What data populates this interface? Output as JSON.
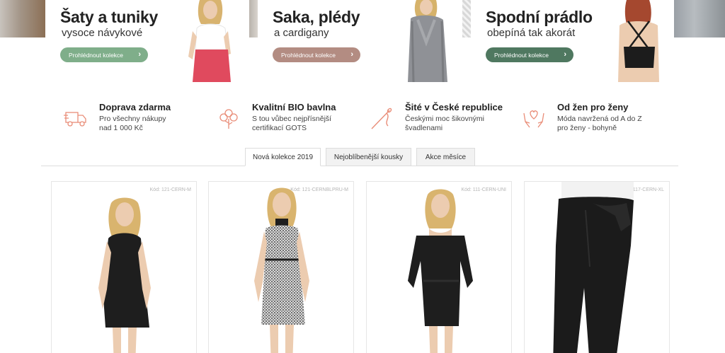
{
  "banners": [
    {
      "title": "Šaty a tuniky",
      "subtitle": "vysoce návykové",
      "button": "Prohlédnout kolekce",
      "button_color": "#7fae8a",
      "chevron": "›"
    },
    {
      "title": "Saka, plédy",
      "subtitle": "a cardigany",
      "button": "Prohlédnout kolekce",
      "button_color": "#b38c82",
      "chevron": "›"
    },
    {
      "title": "Spodní prádlo",
      "subtitle": "obepíná tak akorát",
      "button": "Prohlédnout kolekce",
      "button_color": "#4f7860",
      "chevron": "›"
    }
  ],
  "features": [
    {
      "icon": "truck-icon",
      "title": "Doprava zdarma",
      "line1": "Pro všechny nákupy",
      "line2": "nad 1 000 Kč"
    },
    {
      "icon": "cotton-icon",
      "title": "Kvalitní BIO bavlna",
      "line1": "S tou vůbec nejpřísnější",
      "line2": "certifikací GOTS"
    },
    {
      "icon": "needle-icon",
      "title": "Šité v České republice",
      "line1": "Českými moc šikovnými",
      "line2": "švadlenami"
    },
    {
      "icon": "hands-heart-icon",
      "title": "Od žen pro ženy",
      "line1": "Móda navržená od A do Z",
      "line2": "pro ženy - bohyně"
    }
  ],
  "accent_color": "#e98d78",
  "tabs": [
    {
      "label": "Nová kolekce 2019",
      "active": true
    },
    {
      "label": "Nejoblíbenější kousky",
      "active": false
    },
    {
      "label": "Akce měsíce",
      "active": false
    }
  ],
  "products": [
    {
      "code": "Kód: 121-CERN-M"
    },
    {
      "code": "Kód: 121-CERNBLPRU-M"
    },
    {
      "code": "Kód: 111-CERN-UNI"
    },
    {
      "code": "Kód: 117-CERN-XL"
    }
  ]
}
